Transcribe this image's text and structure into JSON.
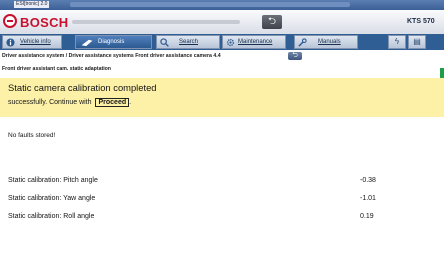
{
  "window": {
    "title": "ESI[tronic] 2.0"
  },
  "header": {
    "brand": "BOSCH",
    "device": "KTS 570",
    "back_symbol": "⮌"
  },
  "tabs": [
    {
      "label": "Vehicle info"
    },
    {
      "label": "Diagnosis"
    },
    {
      "label": "Search"
    },
    {
      "label": "Maintenance"
    },
    {
      "label": "Manuals"
    }
  ],
  "tool_buttons": {
    "flash": "ϟ",
    "doc": "▤"
  },
  "breadcrumb": "Driver assistance system / Driver assistance systems Front driver assistance camera 4.4",
  "breadcrumb_back_symbol": "⮌",
  "sub_breadcrumb": "Front driver assistant cam. static adaptation",
  "banner": {
    "line1": "Static camera calibration completed",
    "line2_prefix": "successfully. Continue with",
    "proceed": "Proceed",
    "line2_suffix": "."
  },
  "status": "No faults stored!",
  "values": [
    {
      "label": "Static calibration: Pitch angle",
      "value": "-0.38"
    },
    {
      "label": "Static calibration: Yaw angle",
      "value": "-1.01"
    },
    {
      "label": "Static calibration: Roll angle",
      "value": "0.19"
    }
  ],
  "colors": {
    "brand_red": "#c8102e",
    "banner_yellow": "#fdf1a8",
    "tab_blue": "#2f5e94"
  }
}
